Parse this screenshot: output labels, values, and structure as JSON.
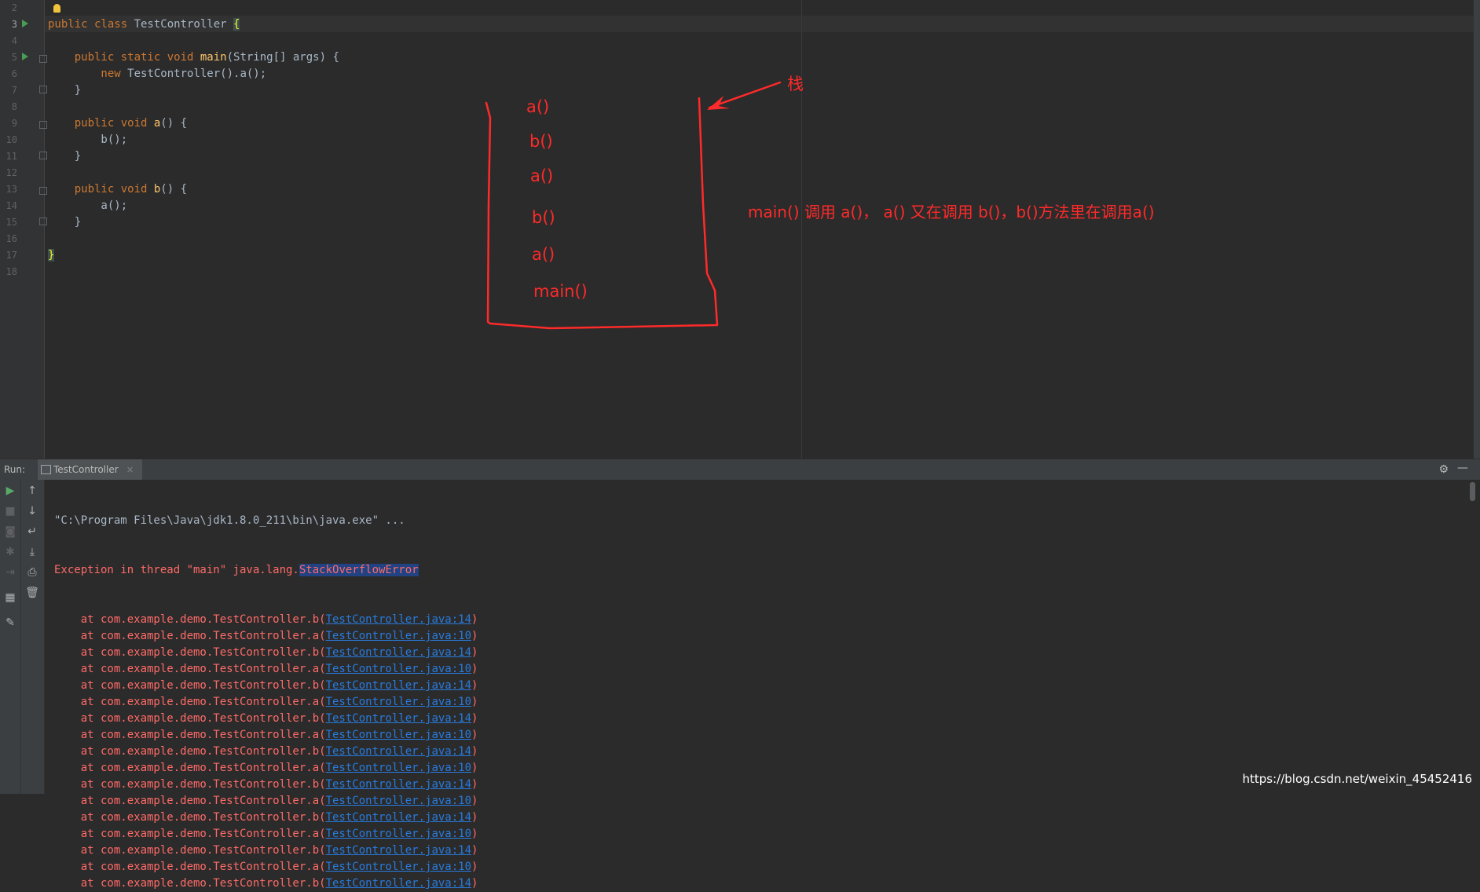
{
  "editor": {
    "line_numbers": [
      "2",
      "3",
      "4",
      "5",
      "6",
      "7",
      "8",
      "9",
      "10",
      "11",
      "12",
      "13",
      "14",
      "15",
      "16",
      "17",
      "18"
    ],
    "code_lines": [
      {
        "segments": []
      },
      {
        "segments": [
          {
            "t": "public class ",
            "c": "kw"
          },
          {
            "t": "TestController ",
            "c": ""
          },
          {
            "t": "{",
            "c": "brace"
          }
        ]
      },
      {
        "segments": []
      },
      {
        "segments": [
          {
            "t": "    public static void ",
            "c": "kw"
          },
          {
            "t": "main",
            "c": "fn"
          },
          {
            "t": "(String[] args) {",
            "c": ""
          }
        ]
      },
      {
        "segments": [
          {
            "t": "        new ",
            "c": "kw"
          },
          {
            "t": "TestController().a();",
            "c": ""
          }
        ]
      },
      {
        "segments": [
          {
            "t": "    }",
            "c": ""
          }
        ]
      },
      {
        "segments": []
      },
      {
        "segments": [
          {
            "t": "    public void ",
            "c": "kw"
          },
          {
            "t": "a",
            "c": "fn"
          },
          {
            "t": "() {",
            "c": ""
          }
        ]
      },
      {
        "segments": [
          {
            "t": "        b();",
            "c": ""
          }
        ]
      },
      {
        "segments": [
          {
            "t": "    }",
            "c": ""
          }
        ]
      },
      {
        "segments": []
      },
      {
        "segments": [
          {
            "t": "    public void ",
            "c": "kw"
          },
          {
            "t": "b",
            "c": "fn"
          },
          {
            "t": "() {",
            "c": ""
          }
        ]
      },
      {
        "segments": [
          {
            "t": "        a();",
            "c": ""
          }
        ]
      },
      {
        "segments": [
          {
            "t": "    }",
            "c": ""
          }
        ]
      },
      {
        "segments": []
      },
      {
        "segments": [
          {
            "t": "}",
            "c": "brace"
          }
        ]
      },
      {
        "segments": []
      }
    ]
  },
  "annotations": {
    "stack_label": "栈",
    "frames": [
      "a()",
      "b()",
      "a()",
      "b()",
      "a()",
      "main()"
    ],
    "note": "main() 调用 a()， a() 又在调用 b()，b()方法里在调用a()",
    "color": "#ff2a2a"
  },
  "run_panel": {
    "label": "Run:",
    "tab": "TestController",
    "tab_close": "×"
  },
  "console": {
    "command": "\"C:\\Program Files\\Java\\jdk1.8.0_211\\bin\\java.exe\" ...",
    "exception_prefix": "Exception in thread \"main\" java.lang.",
    "exception_class": "StackOverflowError",
    "trace": [
      {
        "prefix": "    at com.example.demo.TestController.b(",
        "link": "TestController.java:14",
        "suffix": ")"
      },
      {
        "prefix": "    at com.example.demo.TestController.a(",
        "link": "TestController.java:10",
        "suffix": ")"
      },
      {
        "prefix": "    at com.example.demo.TestController.b(",
        "link": "TestController.java:14",
        "suffix": ")"
      },
      {
        "prefix": "    at com.example.demo.TestController.a(",
        "link": "TestController.java:10",
        "suffix": ")"
      },
      {
        "prefix": "    at com.example.demo.TestController.b(",
        "link": "TestController.java:14",
        "suffix": ")"
      },
      {
        "prefix": "    at com.example.demo.TestController.a(",
        "link": "TestController.java:10",
        "suffix": ")"
      },
      {
        "prefix": "    at com.example.demo.TestController.b(",
        "link": "TestController.java:14",
        "suffix": ")"
      },
      {
        "prefix": "    at com.example.demo.TestController.a(",
        "link": "TestController.java:10",
        "suffix": ")"
      },
      {
        "prefix": "    at com.example.demo.TestController.b(",
        "link": "TestController.java:14",
        "suffix": ")"
      },
      {
        "prefix": "    at com.example.demo.TestController.a(",
        "link": "TestController.java:10",
        "suffix": ")"
      },
      {
        "prefix": "    at com.example.demo.TestController.b(",
        "link": "TestController.java:14",
        "suffix": ")"
      },
      {
        "prefix": "    at com.example.demo.TestController.a(",
        "link": "TestController.java:10",
        "suffix": ")"
      },
      {
        "prefix": "    at com.example.demo.TestController.b(",
        "link": "TestController.java:14",
        "suffix": ")"
      },
      {
        "prefix": "    at com.example.demo.TestController.a(",
        "link": "TestController.java:10",
        "suffix": ")"
      },
      {
        "prefix": "    at com.example.demo.TestController.b(",
        "link": "TestController.java:14",
        "suffix": ")"
      },
      {
        "prefix": "    at com.example.demo.TestController.a(",
        "link": "TestController.java:10",
        "suffix": ")"
      },
      {
        "prefix": "    at com.example.demo.TestController.b(",
        "link": "TestController.java:14",
        "suffix": ")"
      }
    ]
  },
  "watermark": "https://blog.csdn.net/weixin_45452416"
}
